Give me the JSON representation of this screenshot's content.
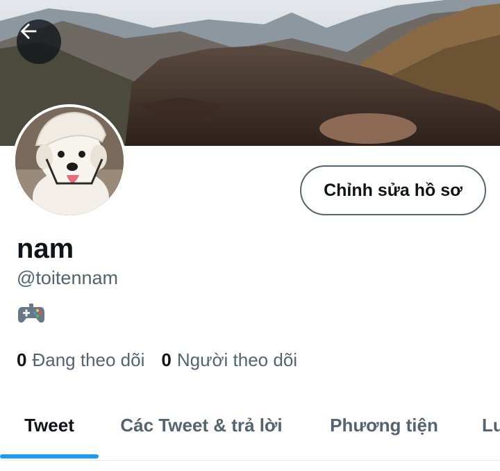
{
  "header": {
    "back_icon": "arrow-left-icon"
  },
  "profile": {
    "display_name": "nam",
    "handle": "@toitennam",
    "bio_icon": "game-controller-icon",
    "edit_button_label": "Chỉnh sửa hồ sơ"
  },
  "stats": [
    {
      "count": "0",
      "label": "Đang theo dõi"
    },
    {
      "count": "0",
      "label": "Người theo dõi"
    }
  ],
  "tabs": [
    {
      "label": "Tweet",
      "active": true
    },
    {
      "label": "Các Tweet & trả lời",
      "active": false
    },
    {
      "label": "Phương tiện",
      "active": false
    },
    {
      "label": "Lư",
      "active": false
    }
  ],
  "colors": {
    "accent": "#1d9bf0",
    "text_primary": "#0f1419",
    "text_secondary": "#536471"
  }
}
